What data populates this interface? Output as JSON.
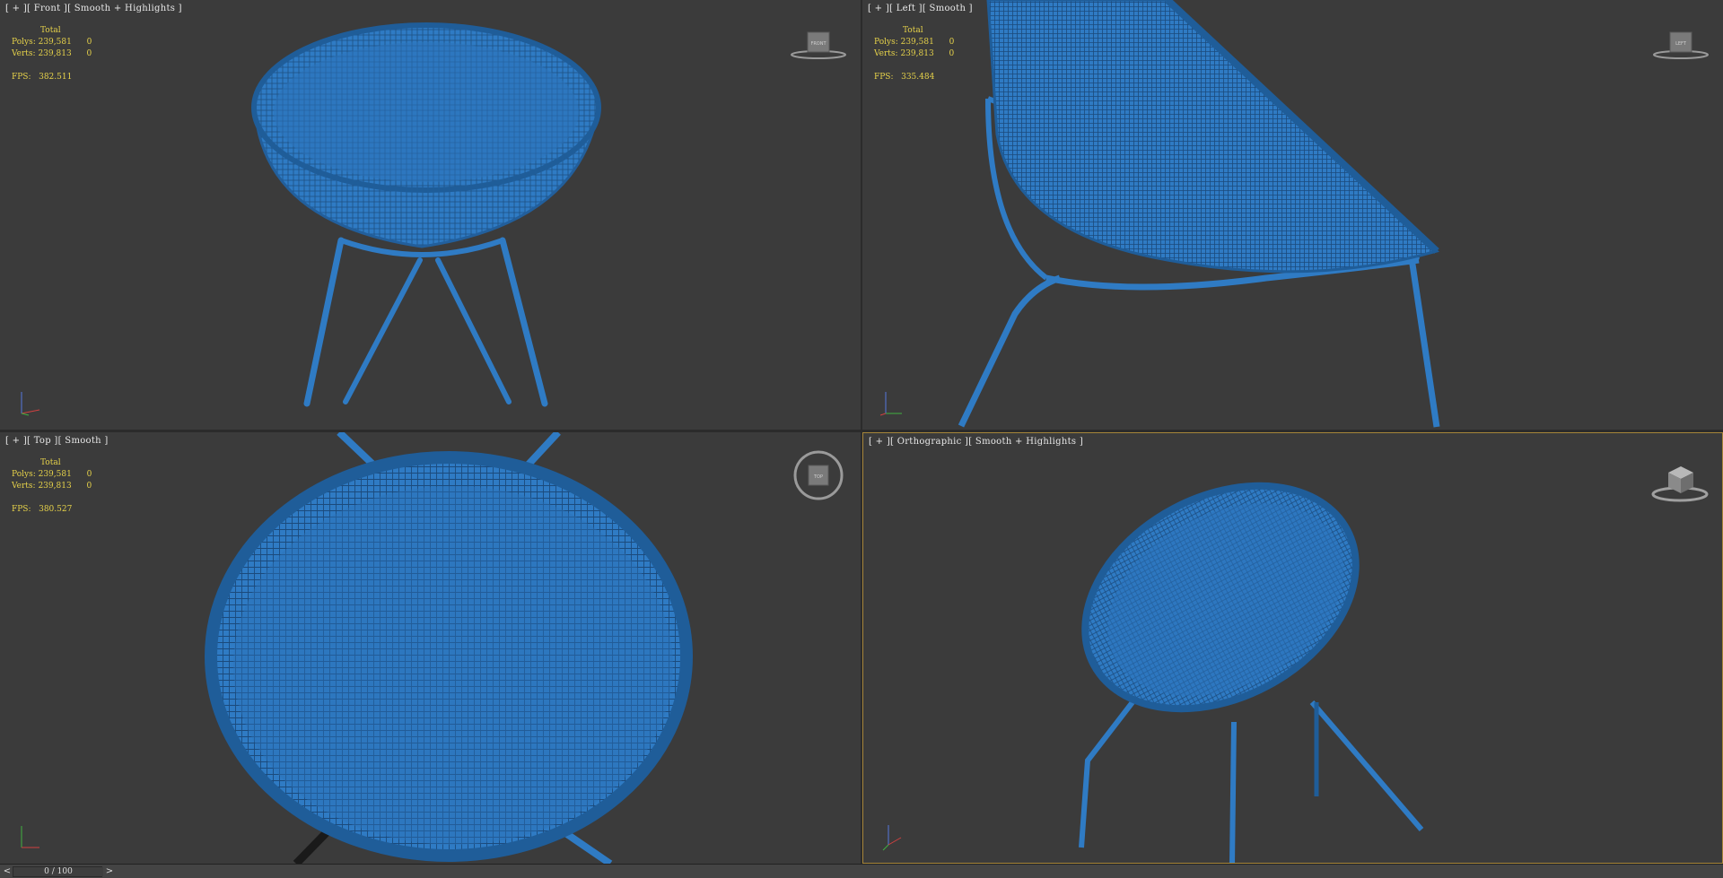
{
  "viewports": {
    "front": {
      "label": "[ + ][ Front ][ Smooth + Highlights ]",
      "stats": {
        "total_label": "Total",
        "polys_label": "Polys:",
        "polys_value": "239,581",
        "polys_sel": "0",
        "verts_label": "Verts:",
        "verts_value": "239,813",
        "verts_sel": "0",
        "fps_label": "FPS:",
        "fps_value": "382.511"
      },
      "cube_label": "FRONT"
    },
    "left": {
      "label": "[ + ][ Left ][ Smooth ]",
      "stats": {
        "total_label": "Total",
        "polys_label": "Polys:",
        "polys_value": "239,581",
        "polys_sel": "0",
        "verts_label": "Verts:",
        "verts_value": "239,813",
        "verts_sel": "0",
        "fps_label": "FPS:",
        "fps_value": "335.484"
      },
      "cube_label": "LEFT"
    },
    "top": {
      "label": "[ + ][ Top ][ Smooth ]",
      "stats": {
        "total_label": "Total",
        "polys_label": "Polys:",
        "polys_value": "239,581",
        "polys_sel": "0",
        "verts_label": "Verts:",
        "verts_value": "239,813",
        "verts_sel": "0",
        "fps_label": "FPS:",
        "fps_value": "380.527"
      },
      "cube_label": "TOP"
    },
    "perspective": {
      "label": "[ + ][ Orthographic ][ Smooth + Highlights ]",
      "active": true
    }
  },
  "timeline": {
    "prev": "<",
    "next": ">",
    "frame": "0 / 100",
    "progress": 0
  },
  "colors": {
    "viewport_bg": "#3b3b3b",
    "model": "#2f7bc4",
    "model_dark": "#1f5d99",
    "stats_text": "#e6d24a",
    "active_border": "#a7863a"
  }
}
